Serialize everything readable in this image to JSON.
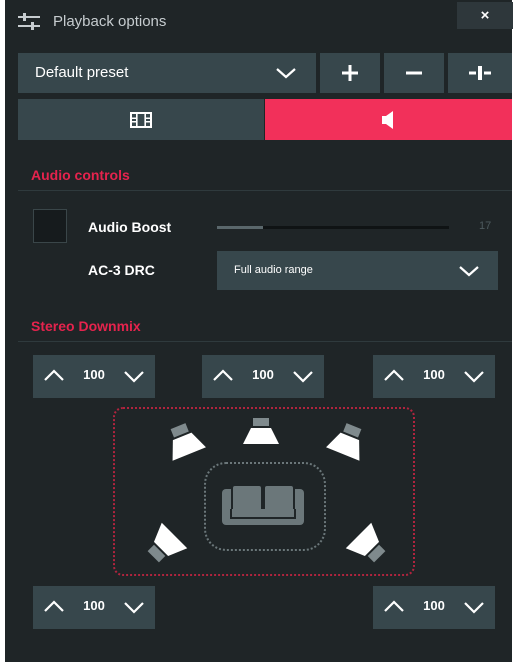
{
  "window": {
    "title": "Playback options",
    "close_label": "×"
  },
  "icons": {
    "title": "sliders-icon",
    "preset_dropdown": "chevron-down-icon",
    "add": "plus-icon",
    "remove": "minus-icon",
    "split": "split-icon",
    "video_tab": "film-icon",
    "audio_tab": "speaker-icon"
  },
  "preset": {
    "selected": "Default preset"
  },
  "tabs": {
    "active": "audio"
  },
  "colors": {
    "accent": "#f2305a",
    "section_title": "#e5234d",
    "panel_bg": "#1f2527",
    "control_bg": "#37474c",
    "room_border": "#b0243e"
  },
  "audio_controls": {
    "title": "Audio controls",
    "audio_boost": {
      "label": "Audio Boost",
      "checked": false,
      "value": "17",
      "fraction": 0.2
    },
    "drc": {
      "label": "AC-3 DRC",
      "selected": "Full audio range"
    }
  },
  "stereo_downmix": {
    "title": "Stereo Downmix",
    "front_left": "100",
    "center": "100",
    "front_right": "100",
    "rear_left": "100",
    "rear_right": "100"
  }
}
